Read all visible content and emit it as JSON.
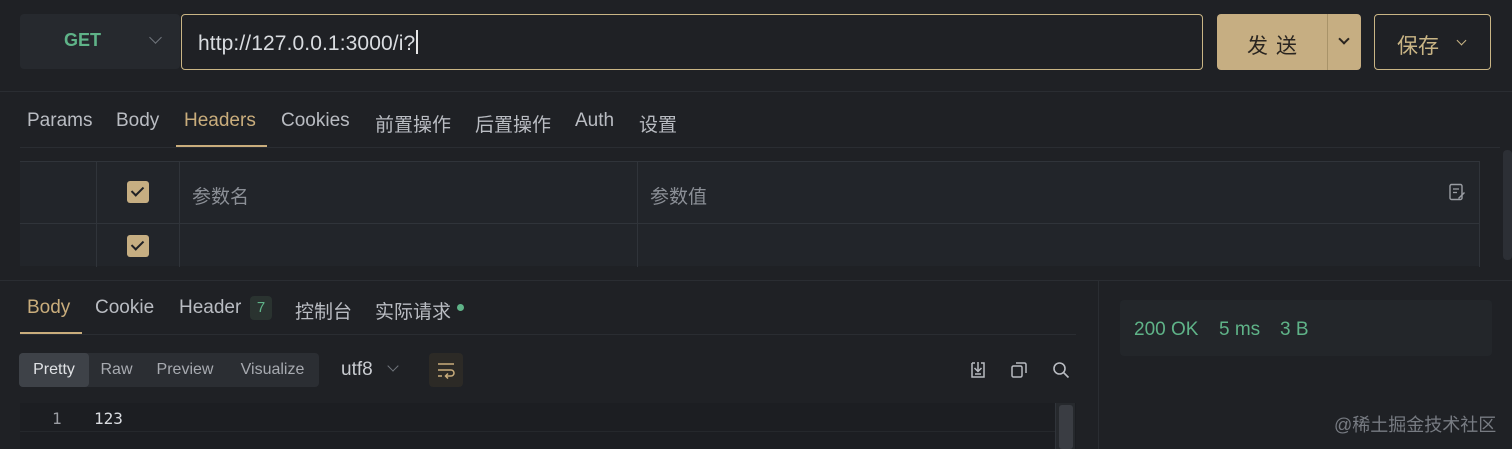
{
  "request": {
    "method": "GET",
    "url": "http://127.0.0.1:3000/i?",
    "send_label": "发送",
    "save_label": "保存"
  },
  "request_tabs": [
    {
      "label": "Params",
      "active": false
    },
    {
      "label": "Body",
      "active": false
    },
    {
      "label": "Headers",
      "active": true
    },
    {
      "label": "Cookies",
      "active": false
    },
    {
      "label": "前置操作",
      "active": false
    },
    {
      "label": "后置操作",
      "active": false
    },
    {
      "label": "Auth",
      "active": false
    },
    {
      "label": "设置",
      "active": false
    }
  ],
  "headers_table": {
    "columns": [
      "参数名",
      "参数值"
    ],
    "rows": [
      {
        "checked": true,
        "name": "",
        "value": ""
      }
    ]
  },
  "response_tabs": [
    {
      "label": "Body",
      "active": true
    },
    {
      "label": "Cookie",
      "active": false
    },
    {
      "label": "Header",
      "active": false,
      "badge": "7"
    },
    {
      "label": "控制台",
      "active": false
    },
    {
      "label": "实际请求",
      "active": false,
      "dot": true
    }
  ],
  "response_formats": [
    {
      "label": "Pretty",
      "active": true
    },
    {
      "label": "Raw",
      "active": false
    },
    {
      "label": "Preview",
      "active": false
    },
    {
      "label": "Visualize",
      "active": false
    }
  ],
  "encoding": "utf8",
  "body_lines": [
    {
      "num": "1",
      "text": "123"
    }
  ],
  "status": {
    "code": "200 OK",
    "time": "5 ms",
    "size": "3 B"
  },
  "watermark": "@稀土掘金技术社区",
  "colors": {
    "accent": "#c6ae82",
    "success": "#5fb388",
    "background": "#1f2125"
  },
  "icons": [
    "chevron-down-icon",
    "edit-icon",
    "word-wrap-icon",
    "download-icon",
    "copy-icon",
    "search-icon"
  ]
}
